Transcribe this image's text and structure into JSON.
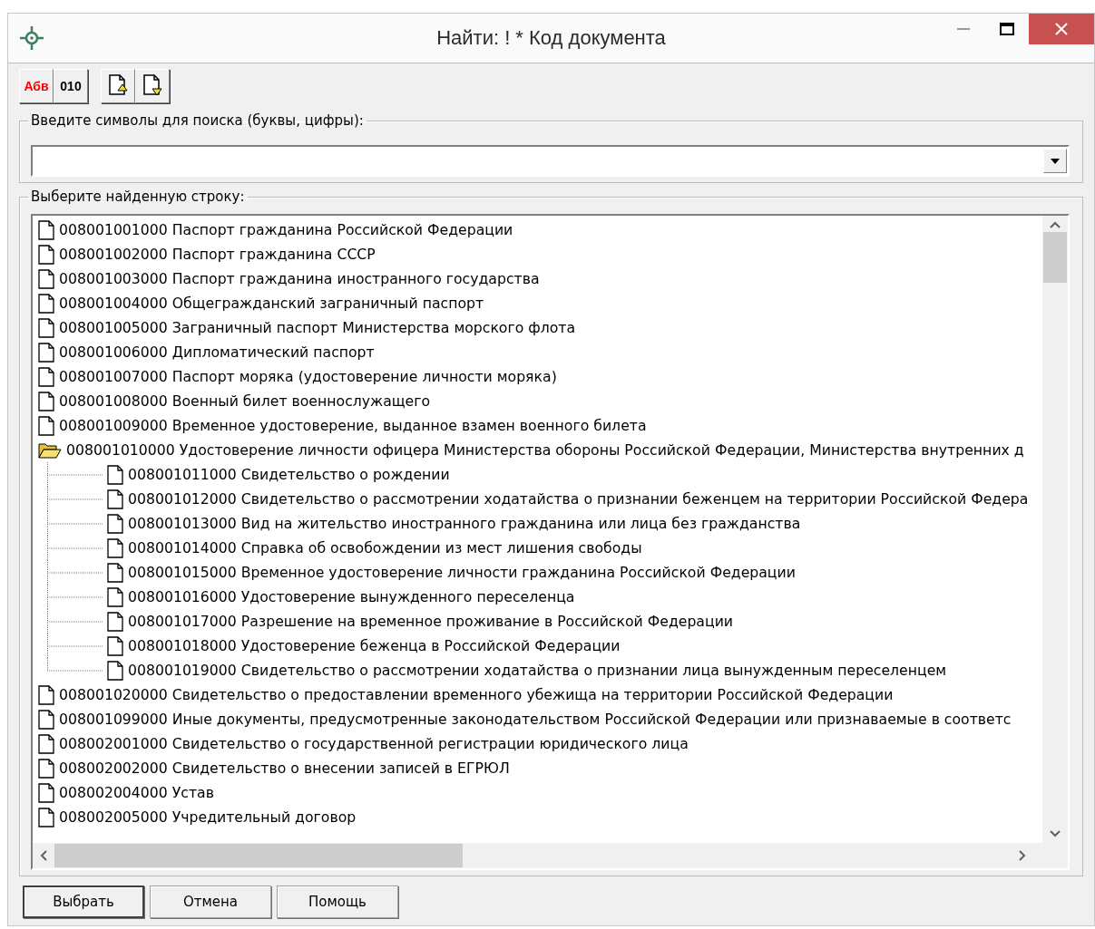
{
  "window": {
    "title": "Найти: ! * Код документа"
  },
  "toolbar": [
    {
      "kind": "letters",
      "label": "Абв"
    },
    {
      "kind": "digits",
      "label": "010"
    },
    {
      "kind": "page-up"
    },
    {
      "kind": "page-down"
    }
  ],
  "search": {
    "legend": "Введите символы для поиска (буквы, цифры):"
  },
  "results": {
    "legend": "Выберите найденную строку:",
    "items": [
      {
        "text": "008001001000 Паспорт гражданина Российской Федерации"
      },
      {
        "text": "008001002000 Паспорт гражданина СССР"
      },
      {
        "text": "008001003000 Паспорт гражданина иностранного государства"
      },
      {
        "text": "008001004000 Общегражданский заграничный паспорт"
      },
      {
        "text": "008001005000 Заграничный паспорт Министерства морского флота"
      },
      {
        "text": "008001006000 Дипломатический паспорт"
      },
      {
        "text": "008001007000 Паспорт моряка (удостоверение личности моряка)"
      },
      {
        "text": "008001008000 Военный билет военнослужащего"
      },
      {
        "text": "008001009000 Временное удостоверение, выданное взамен военного билета"
      },
      {
        "text": "008001010000 Удостоверение личности офицера Министерства обороны Российской Федерации, Министерства внутренних д",
        "expanded": true,
        "children": [
          {
            "text": "008001011000 Свидетельство о рождении"
          },
          {
            "text": "008001012000 Свидетельство о рассмотрении ходатайства о признании беженцем на территории Российской Федера"
          },
          {
            "text": "008001013000 Вид на жительство иностранного гражданина или лица без гражданства"
          },
          {
            "text": "008001014000 Справка об освобождении из мест лишения свободы"
          },
          {
            "text": "008001015000 Временное удостоверение личности гражданина Российской Федерации"
          },
          {
            "text": "008001016000 Удостоверение вынужденного переселенца"
          },
          {
            "text": "008001017000 Разрешение на временное проживание в Российской Федерации"
          },
          {
            "text": "008001018000 Удостоверение беженца в Российской Федерации"
          },
          {
            "text": "008001019000 Свидетельство о рассмотрении ходатайства о признании лица вынужденным переселенцем"
          }
        ]
      },
      {
        "text": "008001020000 Свидетельство о предоставлении временного убежища на территории Российской Федерации"
      },
      {
        "text": "008001099000 Иные документы, предусмотренные законодательством Российской Федерации или признаваемые в соответс"
      },
      {
        "text": "008002001000 Свидетельство о государственной регистрации юридического лица"
      },
      {
        "text": "008002002000 Свидетельство о внесении записей в ЕГРЮЛ"
      },
      {
        "text": "008002004000 Устав"
      },
      {
        "text": "008002005000 Учредительный договор"
      }
    ]
  },
  "buttons": [
    {
      "label": "Выбрать",
      "default": true
    },
    {
      "label": "Отмена",
      "default": false
    },
    {
      "label": "Помощь",
      "default": false
    }
  ]
}
